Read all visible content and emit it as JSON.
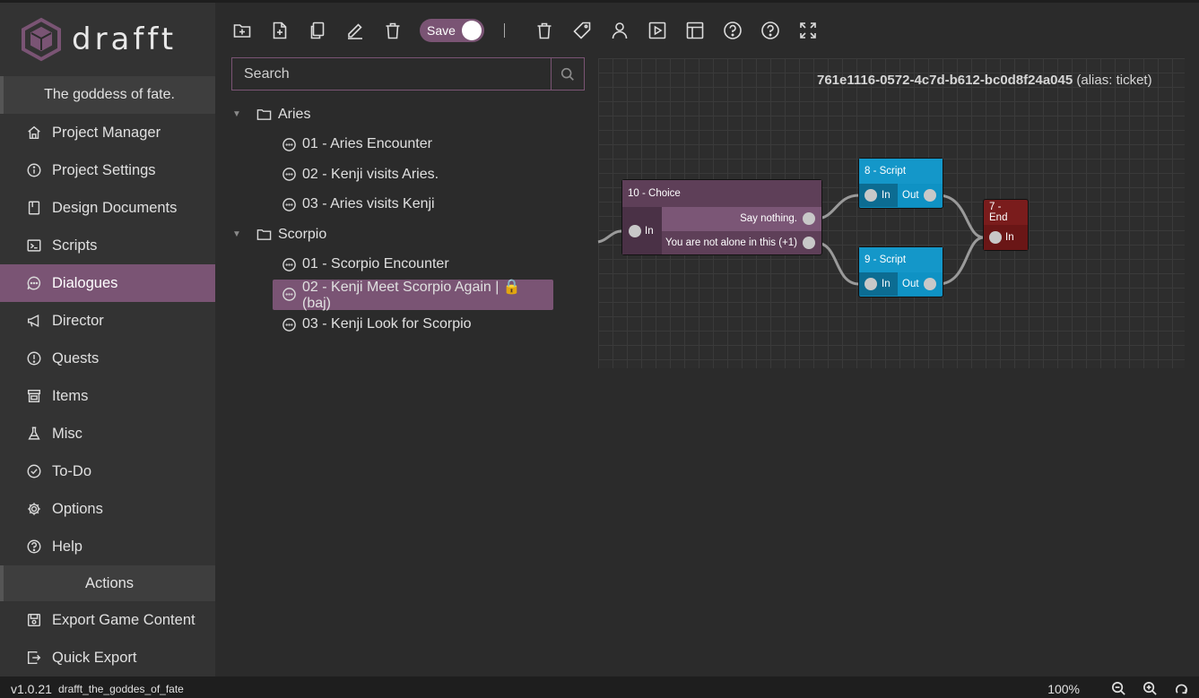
{
  "app": {
    "logo_text": "drafft",
    "project_title": "The goddess of fate."
  },
  "sidebar": {
    "items": [
      {
        "label": "Project Manager",
        "icon": "home-icon"
      },
      {
        "label": "Project Settings",
        "icon": "info-icon"
      },
      {
        "label": "Design Documents",
        "icon": "document-icon"
      },
      {
        "label": "Scripts",
        "icon": "terminal-icon"
      },
      {
        "label": "Dialogues",
        "icon": "chat-bubble-icon",
        "active": true
      },
      {
        "label": "Director",
        "icon": "megaphone-icon"
      },
      {
        "label": "Quests",
        "icon": "alert-circle-icon"
      },
      {
        "label": "Items",
        "icon": "store-icon"
      },
      {
        "label": "Misc",
        "icon": "flask-icon"
      },
      {
        "label": "To-Do",
        "icon": "check-circle-icon"
      },
      {
        "label": "Options",
        "icon": "gear-icon"
      },
      {
        "label": "Help",
        "icon": "help-circle-icon"
      }
    ],
    "actions_header": "Actions",
    "actions": [
      {
        "label": "Export Game Content",
        "icon": "save-icon"
      },
      {
        "label": "Quick Export",
        "icon": "export-icon"
      }
    ]
  },
  "toolbar": {
    "save_label": "Save",
    "save_on": true
  },
  "search": {
    "placeholder": "Search",
    "value": ""
  },
  "tree": {
    "folders": [
      {
        "name": "Aries",
        "children": [
          "01 - Aries Encounter",
          "02 - Kenji visits Aries.",
          "03 - Aries visits Kenji"
        ]
      },
      {
        "name": "Scorpio",
        "children": [
          "01 - Scorpio Encounter",
          "02 - Kenji Meet Scorpio Again | 🔒 (baj)",
          "03 - Kenji Look for Scorpio"
        ]
      }
    ]
  },
  "graph": {
    "node_id": "761e1116-0572-4c7d-b612-bc0d8f24a045",
    "alias_text": "(alias: ticket)",
    "nodes": {
      "choice": {
        "title": "10 - Choice",
        "in_label": "In",
        "option_1": "Say nothing.",
        "option_2": "You are not alone in this (+1)"
      },
      "script_8": {
        "title": "8 - Script",
        "in_label": "In",
        "out_label": "Out"
      },
      "script_9": {
        "title": "9 - Script",
        "in_label": "In",
        "out_label": "Out"
      },
      "end": {
        "title": "7 - End",
        "in_label": "In"
      }
    },
    "colors": {
      "choice": "#5e3f58",
      "script": "#0e8ab8",
      "end": "#7a1c1c",
      "accent": "#7a5474"
    }
  },
  "footer": {
    "version": "v1.0.21",
    "project_file": "drafft_the_goddes_of_fate",
    "zoom": "100%"
  }
}
